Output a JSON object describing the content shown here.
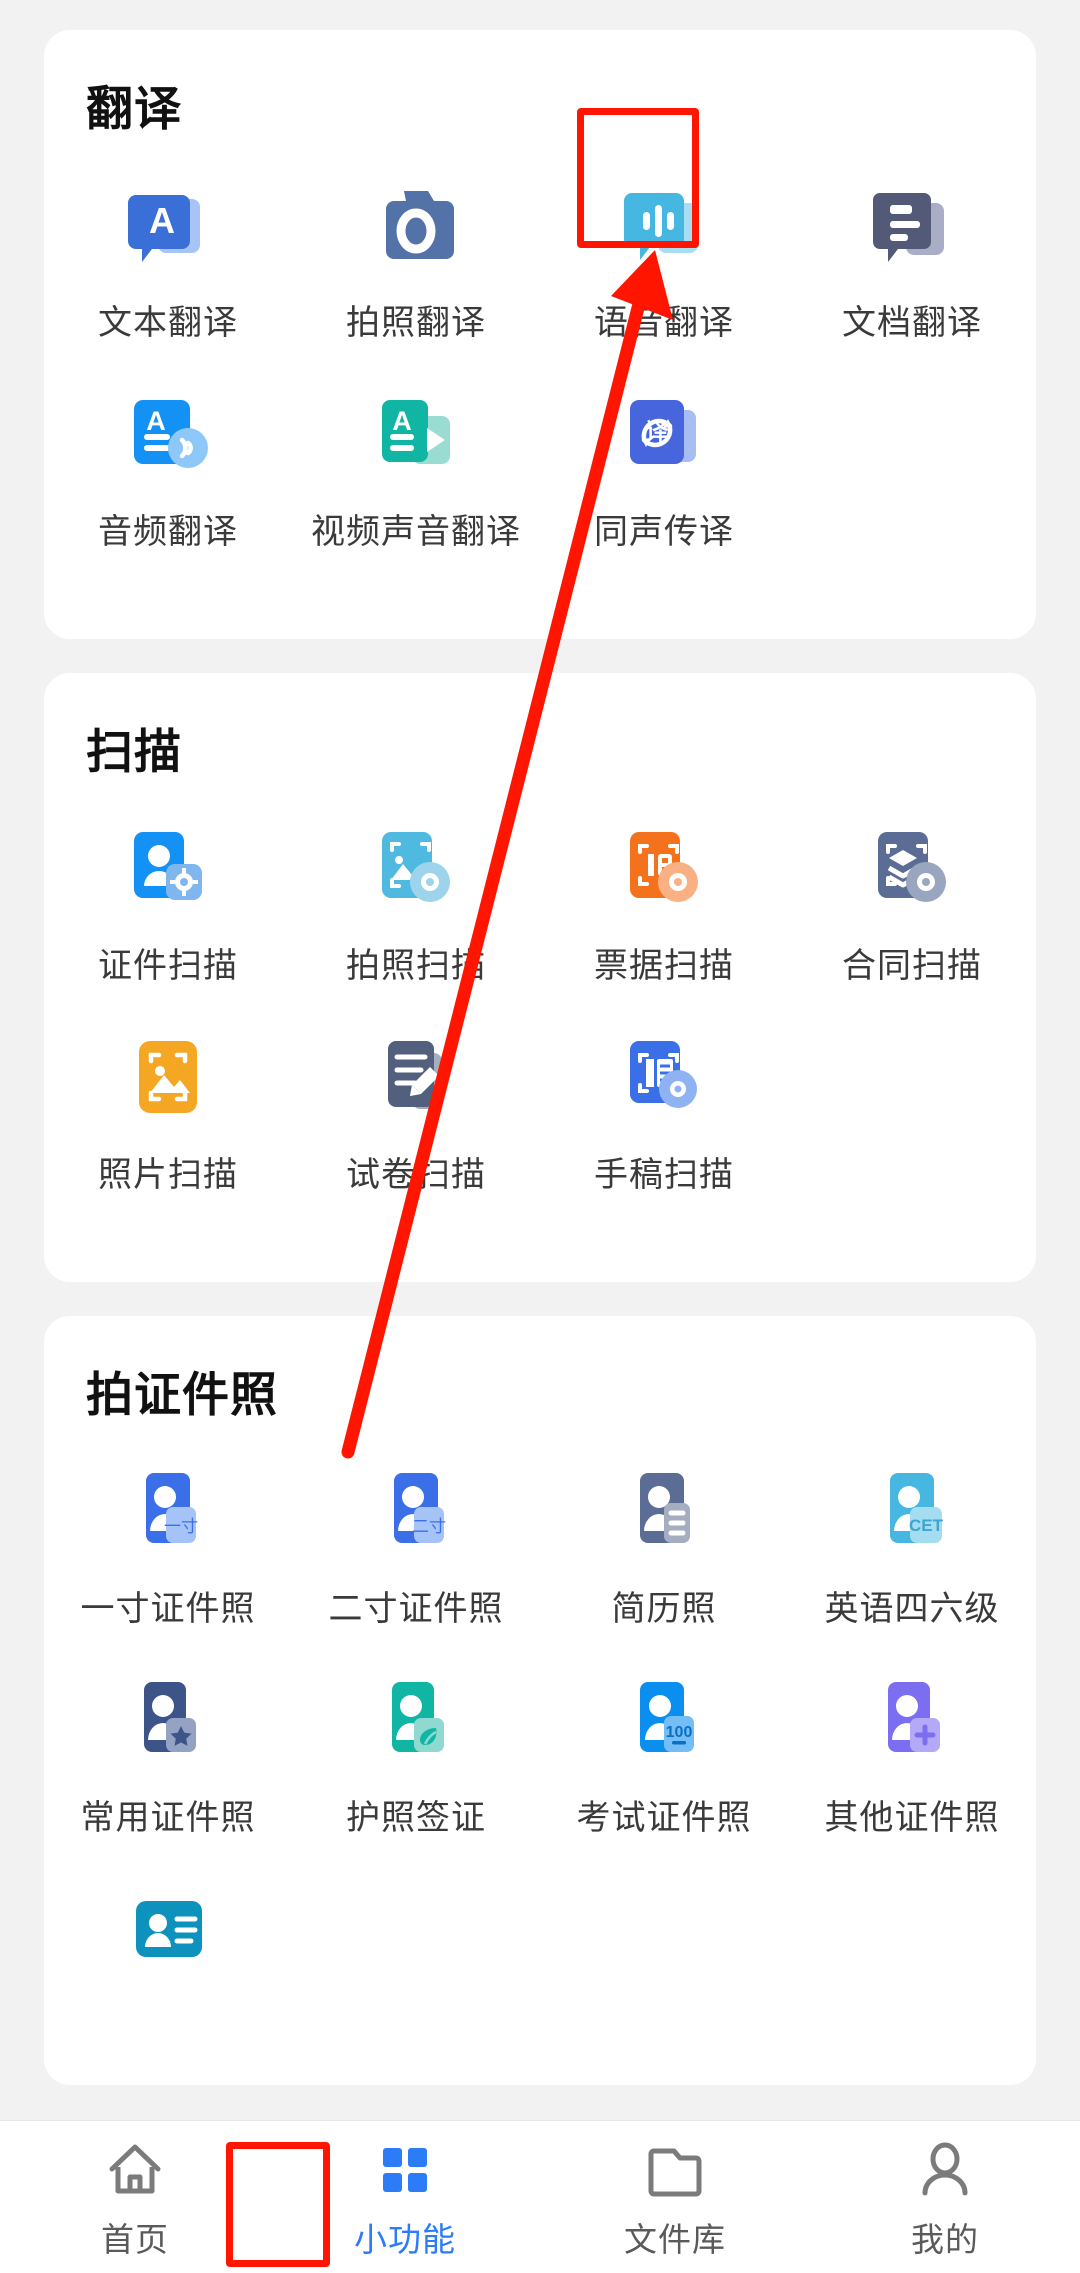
{
  "sections": [
    {
      "title": "翻译",
      "items": [
        {
          "label": "文本翻译",
          "icon": "text-translate-icon"
        },
        {
          "label": "拍照翻译",
          "icon": "camera-translate-icon"
        },
        {
          "label": "语音翻译",
          "icon": "voice-translate-icon"
        },
        {
          "label": "文档翻译",
          "icon": "document-translate-icon"
        },
        {
          "label": "音频翻译",
          "icon": "audio-translate-icon"
        },
        {
          "label": "视频声音翻译",
          "icon": "video-audio-translate-icon"
        },
        {
          "label": "同声传译",
          "icon": "simultaneous-interpretation-icon"
        }
      ]
    },
    {
      "title": "扫描",
      "items": [
        {
          "label": "证件扫描",
          "icon": "id-scan-icon"
        },
        {
          "label": "拍照扫描",
          "icon": "photo-scan-icon"
        },
        {
          "label": "票据扫描",
          "icon": "receipt-scan-icon"
        },
        {
          "label": "合同扫描",
          "icon": "contract-scan-icon"
        },
        {
          "label": "照片扫描",
          "icon": "picture-scan-icon"
        },
        {
          "label": "试卷扫描",
          "icon": "exam-paper-scan-icon"
        },
        {
          "label": "手稿扫描",
          "icon": "manuscript-scan-icon"
        }
      ]
    },
    {
      "title": "拍证件照",
      "items": [
        {
          "label": "一寸证件照",
          "icon": "one-inch-photo-icon",
          "badge": "一寸"
        },
        {
          "label": "二寸证件照",
          "icon": "two-inch-photo-icon",
          "badge": "二寸"
        },
        {
          "label": "简历照",
          "icon": "resume-photo-icon",
          "badge": ""
        },
        {
          "label": "英语四六级",
          "icon": "cet-photo-icon",
          "badge": "CET"
        },
        {
          "label": "常用证件照",
          "icon": "common-photo-icon",
          "badge": "★"
        },
        {
          "label": "护照签证",
          "icon": "passport-visa-photo-icon",
          "badge": "leaf"
        },
        {
          "label": "考试证件照",
          "icon": "exam-photo-icon",
          "badge": "100"
        },
        {
          "label": "其他证件照",
          "icon": "other-photo-icon",
          "badge": "+"
        },
        {
          "label": "",
          "icon": "id-card-photo-icon",
          "badge": ""
        }
      ]
    }
  ],
  "tabbar": {
    "tabs": [
      {
        "label": "首页",
        "icon": "home-icon",
        "active": false
      },
      {
        "label": "小功能",
        "icon": "grid-apps-icon",
        "active": true
      },
      {
        "label": "文件库",
        "icon": "folder-icon",
        "active": false
      },
      {
        "label": "我的",
        "icon": "person-icon",
        "active": false
      }
    ]
  },
  "annotations": {
    "highlight_color": "#ff1500",
    "highlighted_items": [
      "文档翻译",
      "小功能"
    ],
    "arrow": "red-arrow-pointing-to-document-translate"
  }
}
